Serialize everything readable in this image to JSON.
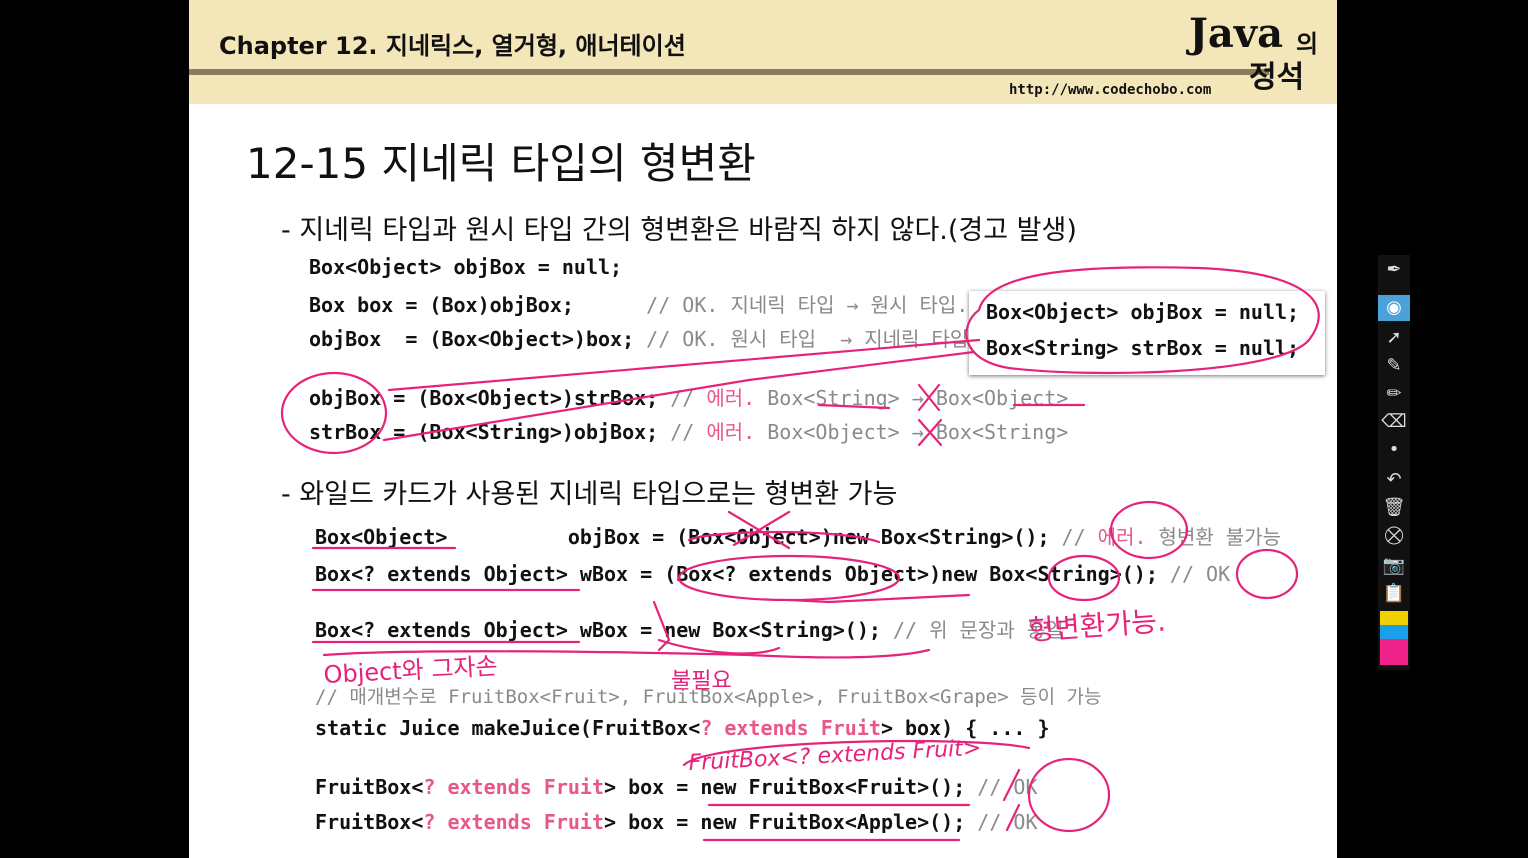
{
  "header": {
    "chapter": "Chapter 12. 지네릭스, 열거형, 애너테이션",
    "logo_java": "Java",
    "logo_ui": "의",
    "logo_jeong": "정석",
    "url": "http://www.codechobo.com"
  },
  "title": "12-15 지네릭 타입의 형변환",
  "section1": {
    "bullet": "- 지네릭 타입과 원시 타입 간의 형변환은 바람직 하지 않다.(경고 발생)",
    "line1": "Box<Object> objBox = null;",
    "line2_code": "Box box = (Box)objBox;      ",
    "line2_comment": "// OK. 지네릭 타입 → 원시 타입.",
    "line3_code": "objBox  = (Box<Object>)box; ",
    "line3_comment": "// OK. 원시 타입  → 지네릭 타입",
    "line4_code": "objBox = (Box<Object>)strBox; ",
    "line4_c1": "// ",
    "line4_err": "에러.",
    "line4_c2": " Box<String> → Box<Object>",
    "line5_code": "strBox = (Box<String>)objBox; ",
    "line5_c1": "// ",
    "line5_err": "에러.",
    "line5_c2": " Box<Object> → Box<String>"
  },
  "popup": {
    "line1": "Box<Object> objBox = null;",
    "line2": "Box<String> strBox = null;"
  },
  "section2": {
    "bullet": "- 와일드 카드가 사용된 지네릭 타입으로는 형변환 가능",
    "line1_code": "Box<Object>          objBox = (Box<Object>)new Box<String>(); ",
    "line1_c1": "// ",
    "line1_err": "에러.",
    "line1_c2": " 형변환 불가능",
    "line2_code": "Box<? extends Object> wBox = (Box<? extends Object>)new Box<String>(); ",
    "line2_comment": "// OK",
    "line3_code": "Box<? extends Object> wBox = new Box<String>(); ",
    "line3_comment": "// 위 문장과 동일",
    "line4_comment": "// 매개변수로 FruitBox<Fruit>, FruitBox<Apple>, FruitBox<Grape> 등이 가능",
    "line5_a": "static Juice makeJuice(FruitBox<",
    "line5_b": "? extends Fruit",
    "line5_c": "> box) { ... }",
    "line6_a": "FruitBox<",
    "line6_b": "? extends Fruit",
    "line6_c": "> box = new FruitBox<Fruit>(); ",
    "line6_comment": "// OK",
    "line7_a": "FruitBox<",
    "line7_b": "? extends Fruit",
    "line7_c": "> box = new FruitBox<Apple>(); ",
    "line7_comment": "// OK"
  },
  "annotations": {
    "note_cast": "형변환가능.",
    "note_object": "Object와 그자손",
    "note_omit": "불필요",
    "note_fruitbox": "FruitBox<? extends Fruit>"
  },
  "colors": {
    "header_bg": "#f3e6b8",
    "ink": "#e6237a",
    "error_text": "#e8578a"
  }
}
